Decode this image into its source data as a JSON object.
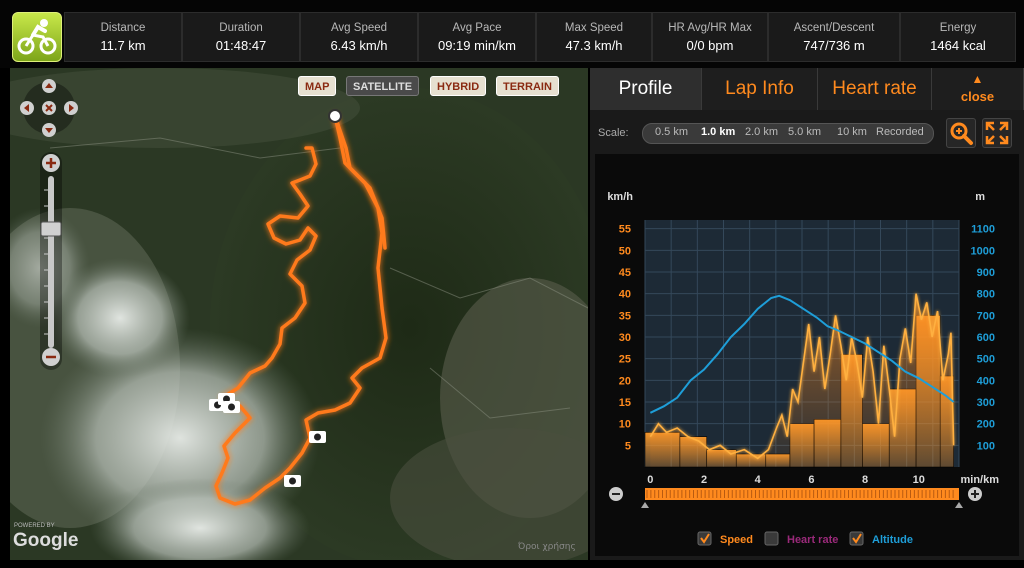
{
  "stats": [
    {
      "label": "Distance",
      "value": "11.7 km"
    },
    {
      "label": "Duration",
      "value": "01:48:47"
    },
    {
      "label": "Avg Speed",
      "value": "6.43 km/h"
    },
    {
      "label": "Avg Pace",
      "value": "09:19 min/km"
    },
    {
      "label": "Max Speed",
      "value": "47.3 km/h"
    },
    {
      "label": "HR Avg/HR Max",
      "value": "0/0 bpm"
    },
    {
      "label": "Ascent/Descent",
      "value": "747/736 m"
    },
    {
      "label": "Energy",
      "value": "1464 kcal"
    }
  ],
  "sport_icon": "cycling-icon",
  "map": {
    "types": [
      {
        "label": "MAP",
        "active": true
      },
      {
        "label": "SATELLITE",
        "active": false
      },
      {
        "label": "HYBRID",
        "active": true
      },
      {
        "label": "TERRAIN",
        "active": true
      }
    ],
    "powered_by": "POWERED BY",
    "google": "Google",
    "copyright": "Όροι χρήσης",
    "route_color": "#ff7a1a",
    "photo_marker_count": 5
  },
  "panel": {
    "tabs": [
      {
        "label": "Profile",
        "active": true
      },
      {
        "label": "Lap Info",
        "active": false
      },
      {
        "label": "Heart rate",
        "active": false
      }
    ],
    "close_label": "close",
    "scale_label": "Scale:",
    "scale_options": [
      "0.5 km",
      "1.0 km",
      "2.0 km",
      "5.0 km",
      "10 km",
      "Recorded"
    ],
    "scale_selected": "1.0 km",
    "zoom_icon": "magnifier-icon",
    "expand_icon": "fullscreen-icon"
  },
  "legend": [
    {
      "label": "Speed",
      "checked": true,
      "color": "#ff8a1e"
    },
    {
      "label": "Heart rate",
      "checked": false,
      "color": "#9a2a7a"
    },
    {
      "label": "Altitude",
      "checked": true,
      "color": "#1e9ed8"
    }
  ],
  "chart_data": {
    "type": "line",
    "xlabel": "min/km",
    "left_unit": "km/h",
    "right_unit": "m",
    "x_ticks": [
      0,
      2,
      4,
      6,
      8,
      10
    ],
    "left_ticks": [
      5,
      10,
      15,
      20,
      25,
      30,
      35,
      40,
      45,
      50,
      55
    ],
    "right_ticks": [
      100,
      200,
      300,
      400,
      500,
      600,
      700,
      800,
      900,
      1000,
      1100
    ],
    "xlim": [
      -0.2,
      11.5
    ],
    "left_ylim": [
      0,
      57
    ],
    "right_ylim": [
      0,
      1140
    ],
    "series": [
      {
        "name": "Speed",
        "axis": "left",
        "values": [
          [
            0,
            7
          ],
          [
            0.3,
            10
          ],
          [
            0.6,
            8
          ],
          [
            1,
            9
          ],
          [
            1.4,
            7
          ],
          [
            1.8,
            6
          ],
          [
            2.2,
            4
          ],
          [
            2.6,
            5
          ],
          [
            3,
            3
          ],
          [
            3.5,
            4
          ],
          [
            4,
            2
          ],
          [
            4.4,
            4
          ],
          [
            4.7,
            9
          ],
          [
            4.9,
            12
          ],
          [
            5.1,
            7
          ],
          [
            5.3,
            18
          ],
          [
            5.5,
            15
          ],
          [
            5.7,
            24
          ],
          [
            5.9,
            33
          ],
          [
            6.1,
            22
          ],
          [
            6.3,
            30
          ],
          [
            6.5,
            18
          ],
          [
            6.7,
            26
          ],
          [
            6.9,
            35
          ],
          [
            7.1,
            28
          ],
          [
            7.3,
            20
          ],
          [
            7.5,
            30
          ],
          [
            7.7,
            24
          ],
          [
            7.9,
            16
          ],
          [
            8.1,
            30
          ],
          [
            8.3,
            22
          ],
          [
            8.5,
            10
          ],
          [
            8.7,
            28
          ],
          [
            8.9,
            18
          ],
          [
            9.1,
            7
          ],
          [
            9.3,
            25
          ],
          [
            9.5,
            32
          ],
          [
            9.7,
            24
          ],
          [
            9.9,
            40
          ],
          [
            10.1,
            34
          ],
          [
            10.3,
            38
          ],
          [
            10.5,
            30
          ],
          [
            10.7,
            36
          ],
          [
            10.9,
            20
          ],
          [
            11.1,
            26
          ],
          [
            11.2,
            31
          ],
          [
            11.3,
            5
          ]
        ]
      },
      {
        "name": "Altitude",
        "axis": "right",
        "values": [
          [
            0,
            250
          ],
          [
            0.5,
            280
          ],
          [
            1,
            320
          ],
          [
            1.5,
            400
          ],
          [
            2,
            450
          ],
          [
            2.5,
            520
          ],
          [
            3,
            600
          ],
          [
            3.5,
            660
          ],
          [
            4,
            730
          ],
          [
            4.5,
            780
          ],
          [
            4.8,
            790
          ],
          [
            5.2,
            770
          ],
          [
            5.7,
            730
          ],
          [
            6.2,
            690
          ],
          [
            6.6,
            650
          ],
          [
            7,
            630
          ],
          [
            7.5,
            600
          ],
          [
            8,
            570
          ],
          [
            8.5,
            530
          ],
          [
            9,
            490
          ],
          [
            9.5,
            440
          ],
          [
            10,
            410
          ],
          [
            10.5,
            370
          ],
          [
            11,
            330
          ],
          [
            11.3,
            300
          ]
        ]
      }
    ],
    "bars": [
      {
        "x0": -0.2,
        "x1": 1.1,
        "value": 8
      },
      {
        "x0": 1.1,
        "x1": 2.1,
        "value": 7
      },
      {
        "x0": 2.1,
        "x1": 3.2,
        "value": 4
      },
      {
        "x0": 3.2,
        "x1": 4.3,
        "value": 3
      },
      {
        "x0": 4.3,
        "x1": 5.2,
        "value": 3
      },
      {
        "x0": 5.2,
        "x1": 6.1,
        "value": 10
      },
      {
        "x0": 6.1,
        "x1": 7.1,
        "value": 11
      },
      {
        "x0": 7.1,
        "x1": 7.9,
        "value": 26
      },
      {
        "x0": 7.9,
        "x1": 8.9,
        "value": 10
      },
      {
        "x0": 8.9,
        "x1": 9.9,
        "value": 18
      },
      {
        "x0": 9.9,
        "x1": 10.8,
        "value": 35
      },
      {
        "x0": 10.8,
        "x1": 11.3,
        "value": 21
      }
    ]
  }
}
